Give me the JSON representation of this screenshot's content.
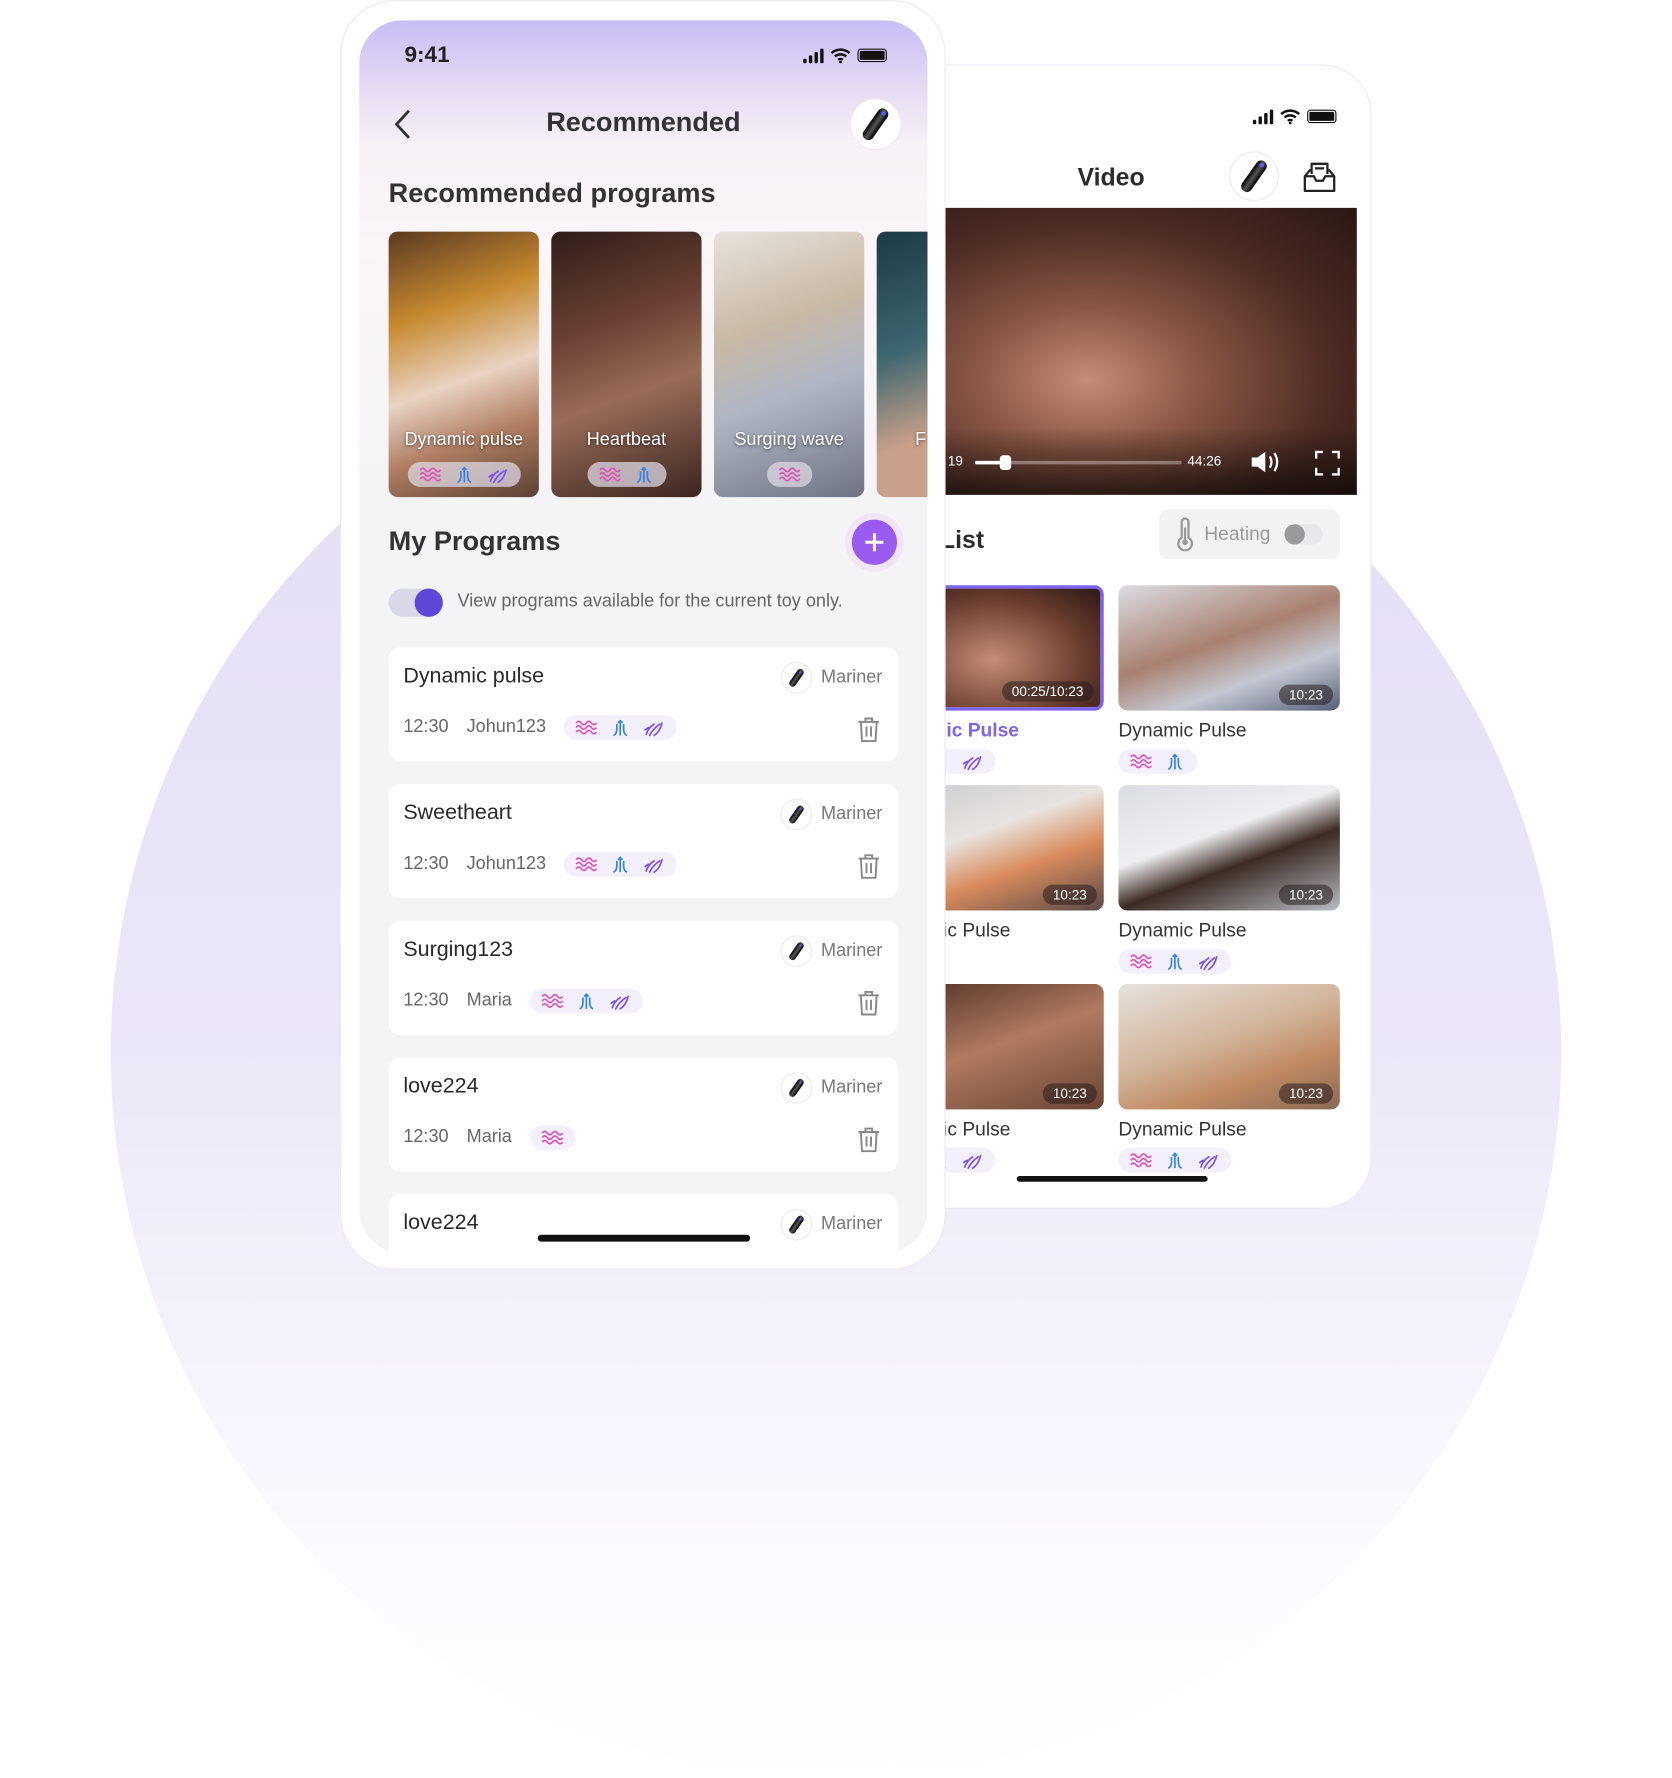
{
  "colors": {
    "accent": "#7d63f2",
    "add_button": "#9a5cf0",
    "wave": "#e04fb7",
    "thrust": "#2f86e8",
    "hand": "#7b4ff0"
  },
  "left_phone": {
    "status_time": "9:41",
    "header": {
      "title": "Recommended",
      "back_icon": "chevron-left-icon"
    },
    "recommended": {
      "title": "Recommended programs",
      "cards": [
        {
          "title": "Dynamic pulse",
          "modes": [
            "wave",
            "thrust",
            "hand"
          ]
        },
        {
          "title": "Heartbeat",
          "modes": [
            "wave",
            "thrust"
          ]
        },
        {
          "title": "Surging wave",
          "modes": [
            "wave"
          ]
        },
        {
          "title": "F",
          "modes": []
        }
      ]
    },
    "my_programs": {
      "title": "My Programs",
      "filter_toggle": {
        "label": "View programs available for the current toy only.",
        "on": true
      },
      "items": [
        {
          "name": "Dynamic pulse",
          "toy": "Mariner",
          "time": "12:30",
          "author": "Johun123",
          "modes": [
            "wave",
            "thrust",
            "hand"
          ]
        },
        {
          "name": "Sweetheart",
          "toy": "Mariner",
          "time": "12:30",
          "author": "Johun123",
          "modes": [
            "wave",
            "thrust",
            "hand"
          ]
        },
        {
          "name": "Surging123",
          "toy": "Mariner",
          "time": "12:30",
          "author": "Maria",
          "modes": [
            "wave",
            "thrust",
            "hand"
          ]
        },
        {
          "name": "love224",
          "toy": "Mariner",
          "time": "12:30",
          "author": "Maria",
          "modes": [
            "wave"
          ]
        },
        {
          "name": "love224",
          "toy": "Mariner",
          "time": "",
          "author": "",
          "modes": []
        }
      ]
    }
  },
  "right_phone": {
    "header": {
      "title": "Video"
    },
    "player": {
      "current_time": "19",
      "duration": "44:26",
      "progress": 0.15
    },
    "list_title": "List",
    "heating": {
      "label": "Heating",
      "on": false
    },
    "videos": [
      {
        "title": "Dynamic Pulse",
        "duration": "00:25/10:23",
        "modes": [
          "wave",
          "thrust",
          "hand"
        ],
        "active": true
      },
      {
        "title": "Dynamic Pulse",
        "duration": "10:23",
        "modes": [
          "wave",
          "thrust"
        ],
        "active": false
      },
      {
        "title": "Dynamic Pulse",
        "duration": "10:23",
        "modes": [],
        "active": false
      },
      {
        "title": "Dynamic Pulse",
        "duration": "10:23",
        "modes": [
          "wave",
          "thrust",
          "hand"
        ],
        "active": false
      },
      {
        "title": "Dynamic Pulse",
        "duration": "10:23",
        "modes": [
          "wave",
          "thrust",
          "hand"
        ],
        "active": false
      },
      {
        "title": "Dynamic Pulse",
        "duration": "10:23",
        "modes": [
          "wave",
          "thrust",
          "hand"
        ],
        "active": false
      }
    ]
  }
}
